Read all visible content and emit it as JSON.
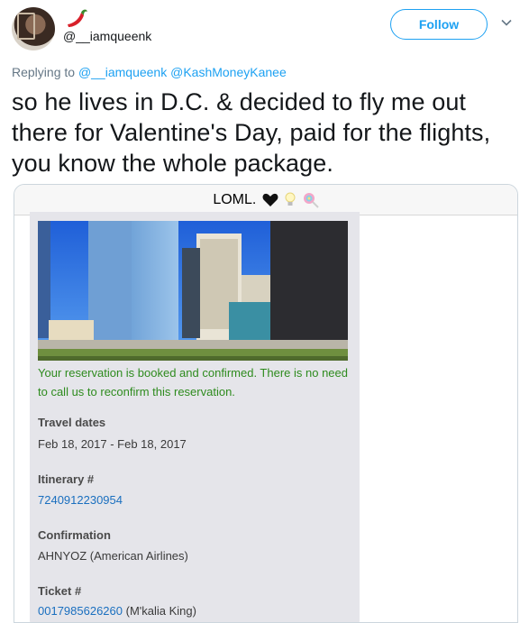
{
  "header": {
    "handle": "@__iamqueenk",
    "follow_label": "Follow"
  },
  "reply": {
    "prefix": "Replying to",
    "mention1": "@__iamqueenk",
    "mention2": "@KashMoneyKanee"
  },
  "tweet": {
    "text": "so he lives in D.C. & decided to fly me out there for Valentine's Day, paid for the flights, you know the whole package."
  },
  "media": {
    "contact_name": "LOML.",
    "confirmation_text": "Your reservation is booked and confirmed. There is no need to call us to reconfirm this reservation.",
    "travel_dates_label": "Travel dates",
    "travel_dates_value": "Feb 18, 2017 - Feb 18, 2017",
    "itinerary_label": "Itinerary #",
    "itinerary_value": "7240912230954",
    "confirmation_label": "Confirmation",
    "confirmation_value": "AHNYOZ (American Airlines)",
    "ticket_label": "Ticket #",
    "ticket_number": "0017985626260",
    "ticket_name": " (M'kalia King)"
  },
  "colors": {
    "accent": "#1da1f2",
    "confirm_green": "#2e8b1e",
    "link_blue": "#1a6fbf"
  }
}
